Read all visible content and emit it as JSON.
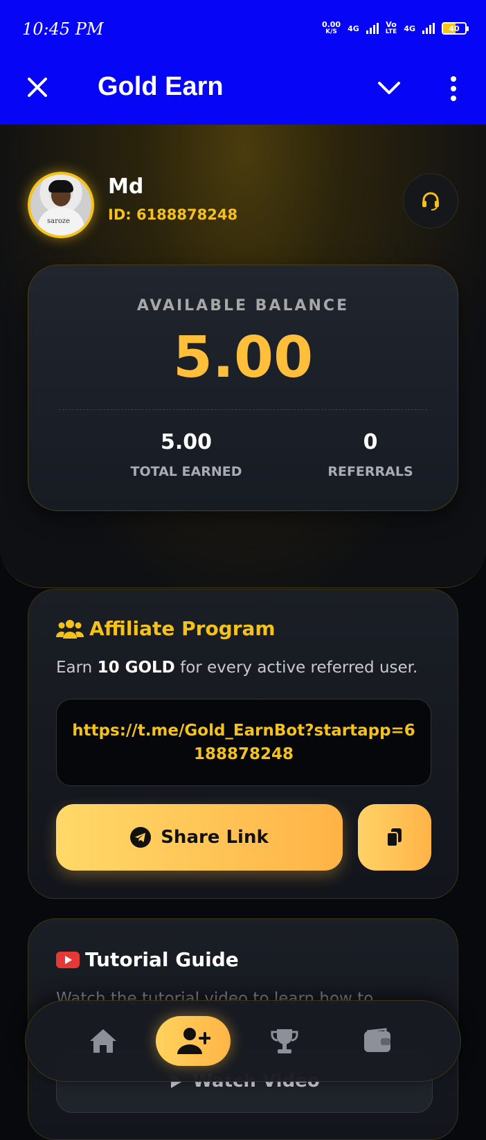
{
  "status_bar": {
    "time": "10:45 PM",
    "net_speed_value": "0.00",
    "net_speed_unit": "K/S",
    "network_1": "4G",
    "volte_top": "Vo",
    "volte_bottom": "LTE",
    "network_2": "4G",
    "battery": "40"
  },
  "app_bar": {
    "title": "Gold Earn",
    "icons": [
      "close-icon",
      "chevron-down-icon",
      "more-vert-icon"
    ]
  },
  "profile": {
    "name": "Md",
    "id_label": "ID: 6188878248",
    "avatar_shirt_text": "saroze",
    "support_icon": "headset-icon"
  },
  "balance": {
    "label": "AVAILABLE BALANCE",
    "value": "5.00",
    "total_earned_value": "5.00",
    "total_earned_label": "TOTAL EARNED",
    "referrals_value": "0",
    "referrals_label": "REFERRALS"
  },
  "affiliate": {
    "title": "Affiliate Program",
    "desc_prefix": "Earn ",
    "desc_bold": "10 GOLD",
    "desc_suffix": " for every active referred user.",
    "link": "https://t.me/Gold_EarnBot?startapp=6188878248",
    "share_label": "Share Link",
    "icons": [
      "users-icon",
      "telegram-icon",
      "copy-icon"
    ]
  },
  "tutorial": {
    "title": "Tutorial Guide",
    "desc": "Watch the tutorial video to learn how to",
    "watch_label": "Watch Video",
    "icons": [
      "youtube-icon",
      "play-icon"
    ]
  },
  "bottom_nav": {
    "items": [
      "home-icon",
      "add-user-icon",
      "trophy-icon",
      "wallet-icon"
    ],
    "active": "add-user-icon"
  },
  "colors": {
    "app_bar": "#0605f5",
    "accent_gold": "#f5c21b",
    "balance_gold": "#ffbf3a",
    "background": "#07090c"
  }
}
